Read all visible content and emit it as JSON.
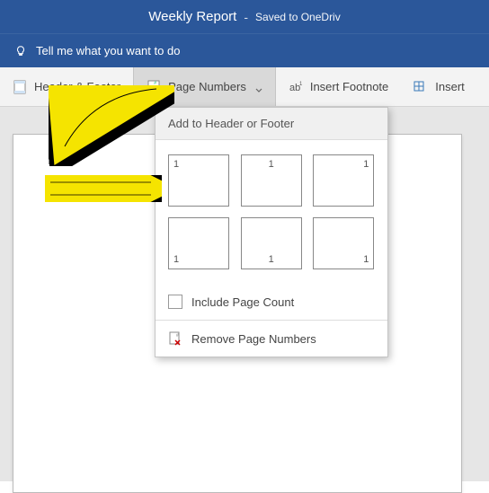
{
  "titlebar": {
    "title": "Weekly Report",
    "separator": "-",
    "status": "Saved to OneDriv"
  },
  "searchbar": {
    "placeholder": "Tell me what you want to do"
  },
  "ribbon": {
    "header_footer": "Header & Footer",
    "page_numbers": "Page Numbers",
    "insert_footnote": "Insert Footnote",
    "insert": "Insert"
  },
  "dropdown": {
    "header": "Add to Header or Footer",
    "sample": "1",
    "include_page_count": "Include Page Count",
    "remove_page_numbers": "Remove Page Numbers"
  }
}
